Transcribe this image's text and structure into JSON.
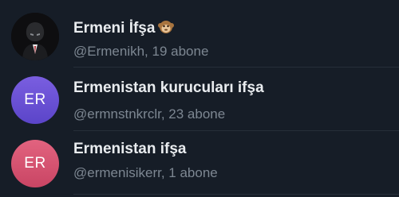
{
  "results": [
    {
      "title": "Ermeni İfşa",
      "title_emoji": "monkey-emoji",
      "subtitle": "@Ermenikh, 19 abone",
      "avatar_type": "photo",
      "avatar_description_icon": "masked-figure-avatar"
    },
    {
      "title": "Ermenistan kurucuları ifşa",
      "subtitle": "@ermnstnkrclr, 23 abone",
      "avatar_initials": "ER",
      "avatar_color": "#6a51d6"
    },
    {
      "title": "Ermenistan ifşa",
      "subtitle": "@ermenisikerr, 1 abone",
      "avatar_initials": "ER",
      "avatar_color": "#d9546f"
    }
  ],
  "colors": {
    "background": "#161d27",
    "title": "#e9ecef",
    "subtitle": "#7d8792",
    "divider": "#262e39"
  }
}
